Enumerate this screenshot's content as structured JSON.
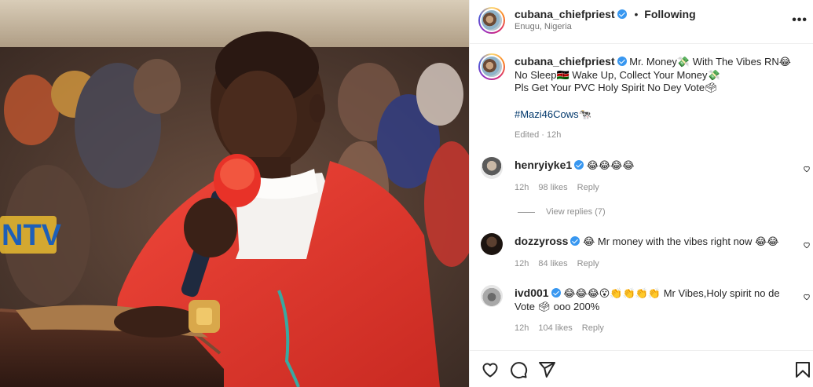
{
  "post": {
    "author": "cubana_chiefpriest",
    "separator": "•",
    "follow_status": "Following",
    "location": "Enugu, Nigeria",
    "more_label": "•••"
  },
  "photo": {
    "channel_logo": "NTV",
    "alt_subject": "man in red vestments speaking into a red microphone"
  },
  "caption": {
    "author": "cubana_chiefpriest",
    "line1": "Mr. Money💸 With The Vibes RN😂",
    "line2": "No Sleep🇰🇪 Wake Up, Collect Your Money💸",
    "line3": "Pls Get Your PVC Holy Spirit No Dey Vote🗳",
    "hashtag": "#Mazi46Cows🐄",
    "meta": "Edited · 12h"
  },
  "comments": [
    {
      "user": "henryiyke1",
      "text": "😂😂😂😂",
      "time": "12h",
      "likes": "98 likes",
      "reply": "Reply"
    },
    {
      "user": "dozzyross",
      "text": "😂 Mr money with the vibes right now 😂😂",
      "time": "12h",
      "likes": "84 likes",
      "reply": "Reply"
    },
    {
      "user": "ivd001",
      "text": "😂😂😂😮👏👏👏👏 Mr Vibes,Holy spirit no de Vote 🗳 ooo 200%",
      "time": "12h",
      "likes": "104 likes",
      "reply": "Reply"
    }
  ],
  "view_replies": "View replies (7)",
  "actions": {
    "like_icon": "heart-icon",
    "comment_icon": "comment-icon",
    "share_icon": "send-icon",
    "save_icon": "bookmark-icon"
  },
  "colors": {
    "verified": "#3897f0",
    "hashtag": "#00376b",
    "muted": "#8e8e8e",
    "vestment": "#e3352b"
  }
}
